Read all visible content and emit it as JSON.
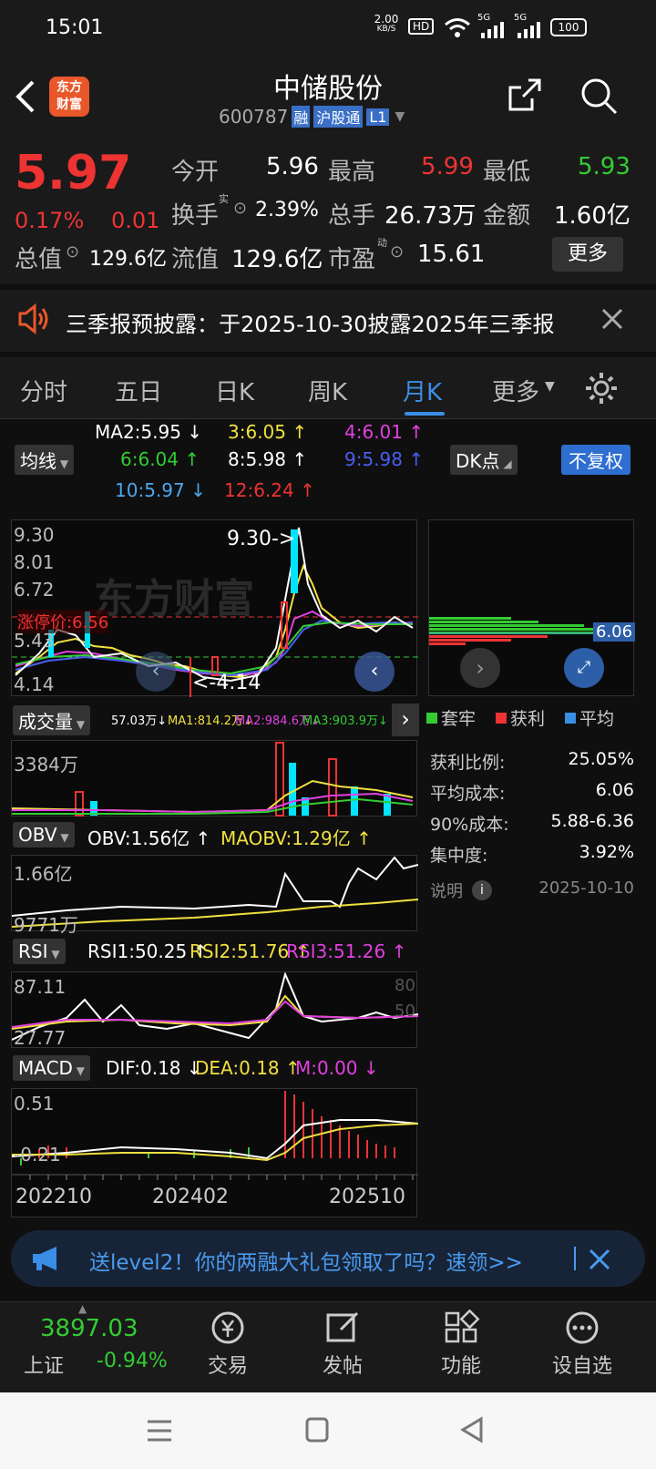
{
  "status": {
    "time": "15:01",
    "net_speed_value": "2.00",
    "net_speed_unit": "KB/S",
    "hd": "HD",
    "sig1": "5G",
    "sig2": "5G",
    "battery": "100"
  },
  "header": {
    "title": "中储股份",
    "code": "600787",
    "tag_rong": "融",
    "tag_hgt": "沪股通",
    "tag_l1": "L1",
    "logo_line1": "东方",
    "logo_line2": "财富"
  },
  "quote": {
    "price": "5.97",
    "change_pct": "0.17%",
    "change": "0.01",
    "open_label": "今开",
    "open": "5.96",
    "high_label": "最高",
    "high": "5.99",
    "low_label": "最低",
    "low": "5.93",
    "turnover_label": "换手",
    "turnover_sup": "实",
    "turnover": "2.39%",
    "volume_label": "总手",
    "volume": "26.73万",
    "amount_label": "金额",
    "amount": "1.60亿",
    "mktcap_label": "总值",
    "mktcap": "129.6亿",
    "float_label": "流值",
    "float": "129.6亿",
    "pe_label": "市盈",
    "pe_sup": "动",
    "pe": "15.61",
    "more": "更多"
  },
  "notice": {
    "text": "三季报预披露：于2025-10-30披露2025年三季报"
  },
  "tabs": {
    "items": [
      "分时",
      "五日",
      "日K",
      "周K",
      "月K",
      "更多"
    ],
    "active": 4
  },
  "ma": {
    "selector": "均线",
    "dk": "DK点",
    "fq": "不复权",
    "ma2": "MA2:5.95 ↓",
    "ma3": "3:6.05 ↑",
    "ma4": "4:6.01 ↑",
    "ma6": "6:6.04 ↑",
    "ma8": "8:5.98 ↑",
    "ma9": "9:5.98 ↑",
    "ma10": "10:5.97 ↓",
    "ma12": "12:6.24 ↑"
  },
  "kline": {
    "y_labels": [
      "9.30",
      "8.01",
      "6.72",
      "5.43",
      "4.14"
    ],
    "limit_label": "涨停价:6.56",
    "high_marker": "9.30->",
    "low_marker": "<-4.14",
    "watermark": "东方财富",
    "cost_value": "6.06"
  },
  "volume": {
    "selector": "成交量",
    "v": "57.03万↓",
    "ma1": "MA1:814.2万↓",
    "ma2": "MA2:984.6万↓",
    "ma3": "MA3:903.9万↓",
    "y_label": "3384万"
  },
  "obv": {
    "selector": "OBV",
    "obv": "OBV:1.56亿 ↑",
    "maobv": "MAOBV:1.29亿 ↑",
    "y_top": "1.66亿",
    "y_bottom": "9771万"
  },
  "rsi": {
    "selector": "RSI",
    "r1": "RSI1:50.25 ↑",
    "r2": "RSI2:51.76 ↑",
    "r3": "RSI3:51.26 ↑",
    "y_top": "87.11",
    "y_bottom": "27.77",
    "level80": "80",
    "level50": "50"
  },
  "macd": {
    "selector": "MACD",
    "dif": "DIF:0.18 ↓",
    "dea": "DEA:0.18 ↑",
    "m": "M:0.00 ↓",
    "y_top": "0.51",
    "y_bottom": "-0.21"
  },
  "x_axis": [
    "202210",
    "202402",
    "202510"
  ],
  "chips": {
    "legend": [
      "套牢",
      "获利",
      "平均"
    ],
    "rows": [
      {
        "label": "获利比例:",
        "value": "25.05%"
      },
      {
        "label": "平均成本:",
        "value": "6.06"
      },
      {
        "label": "90%成本:",
        "value": "5.88-6.36"
      },
      {
        "label": "集中度:",
        "value": "3.92%"
      }
    ],
    "note_label": "说明",
    "date": "2025-10-10"
  },
  "banner": {
    "text": "送level2！你的两融大礼包领取了吗？速领>>"
  },
  "bottom": {
    "index_value": "3897.03",
    "index_name": "上证",
    "index_change": "-0.94%",
    "items": [
      "交易",
      "发帖",
      "功能",
      "设自选"
    ]
  },
  "colors": {
    "up": "#e33",
    "down": "#3c3",
    "accent": "#3a8ee6",
    "yellow": "#f0e040",
    "magenta": "#e040e0",
    "cyan": "#00e5ff"
  },
  "chart_data": [
    {
      "type": "line",
      "title": "月K",
      "x": [
        "202210",
        "202402",
        "202510"
      ],
      "ylim": [
        4.14,
        9.3
      ],
      "series": [
        {
          "values": [
            5.2,
            5.5,
            5.6,
            5.3,
            4.9,
            4.6,
            4.3,
            5.0,
            9.3,
            6.6,
            6.3,
            6.0,
            5.97
          ]
        }
      ]
    }
  ]
}
